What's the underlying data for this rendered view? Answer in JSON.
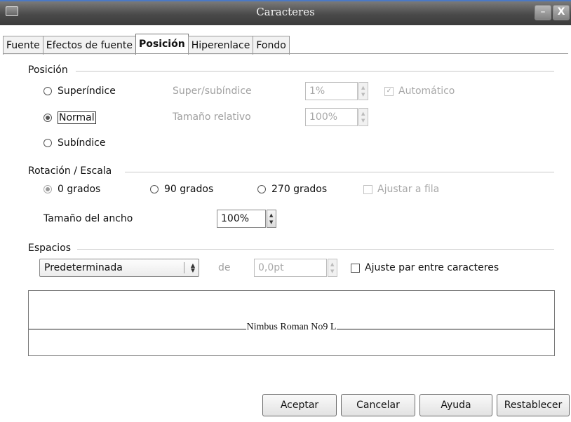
{
  "window": {
    "title": "Caracteres",
    "minimize_glyph": "–",
    "close_glyph": "X"
  },
  "tabs": [
    {
      "label": "Fuente"
    },
    {
      "label": "Efectos de fuente"
    },
    {
      "label": "Posición",
      "active": true
    },
    {
      "label": "Hiperenlace"
    },
    {
      "label": "Fondo"
    }
  ],
  "position": {
    "section_label": "Posición",
    "superscript_label": "Superíndice",
    "normal_label": "Normal",
    "subscript_label": "Subíndice",
    "selected": "Normal",
    "raise_label": "Super/subíndice",
    "raise_value": "1%",
    "relsize_label": "Tamaño relativo",
    "relsize_value": "100%",
    "automatic_label": "Automático",
    "automatic_checked": true
  },
  "rotation": {
    "section_label": "Rotación / Escala",
    "deg0_label": "0 grados",
    "deg90_label": "90 grados",
    "deg270_label": "270 grados",
    "selected": "0 grados",
    "fit_line_label": "Ajustar a fila",
    "fit_line_checked": false,
    "width_label": "Tamaño del ancho",
    "width_value": "100%"
  },
  "spacing": {
    "section_label": "Espacios",
    "type_value": "Predeterminada",
    "by_label": "de",
    "by_value": "0,0pt",
    "kerning_label": "Ajuste par entre caracteres",
    "kerning_checked": false
  },
  "preview": {
    "sample_text": "Nimbus Roman No9 L"
  },
  "buttons": {
    "ok": "Aceptar",
    "cancel": "Cancelar",
    "help": "Ayuda",
    "reset": "Restablecer"
  },
  "colors": {
    "titlebar": "#4a4a4a",
    "accent_line": "#4a78c4",
    "disabled_text": "#a0a0a0"
  },
  "icons": {
    "window_menu": "window-menu-icon",
    "spin_up": "spin-up-arrow-icon",
    "spin_down": "spin-down-arrow-icon",
    "combo": "combo-arrows-icon"
  }
}
